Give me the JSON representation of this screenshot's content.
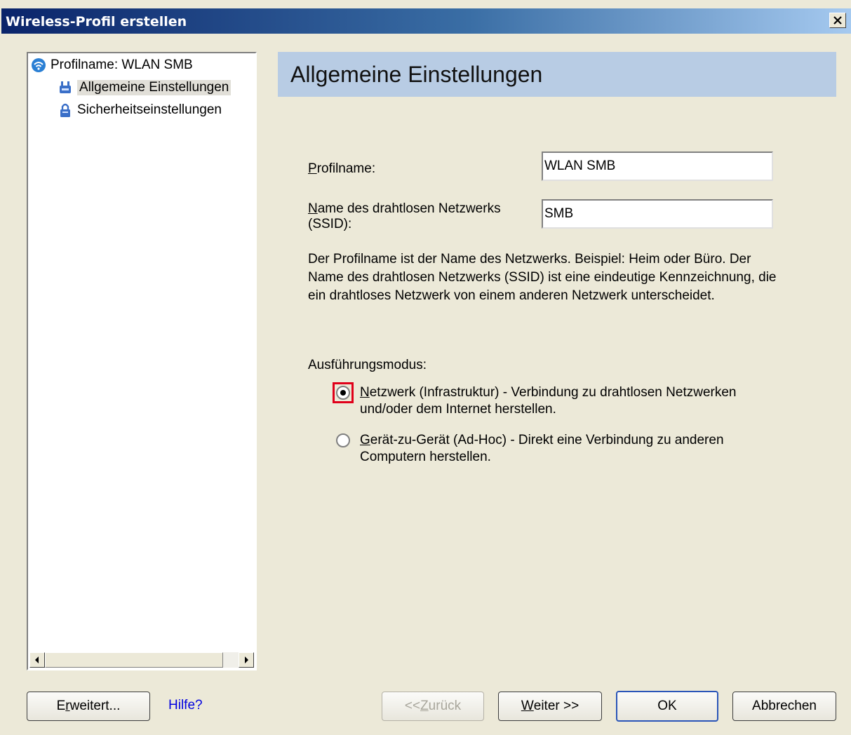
{
  "window": {
    "title": "Wireless-Profil erstellen"
  },
  "tree": {
    "root": "Profilname: WLAN SMB",
    "items": [
      {
        "label": "Allgemeine Einstellungen",
        "icon": "network-adapter-icon",
        "selected": true
      },
      {
        "label": "Sicherheitseinstellungen",
        "icon": "padlock-icon",
        "selected": false
      }
    ]
  },
  "main": {
    "heading": "Allgemeine Einstellungen",
    "profile_label_first": "P",
    "profile_label_rest": "rofilname:",
    "profile_value": "WLAN SMB",
    "ssid_label_first": "N",
    "ssid_label_rest": "ame des drahtlosen Netzwerks",
    "ssid_label_line2": "(SSID):",
    "ssid_value": "SMB",
    "description": "Der Profilname ist der Name des Netzwerks. Beispiel: Heim oder Büro. Der Name des drahtlosen Netzwerks (SSID) ist eine eindeutige Kennzeichnung, die ein drahtloses Netzwerk von einem anderen Netzwerk unterscheidet.",
    "mode_label": "Ausführungsmodus:",
    "mode_options": [
      {
        "key": "N",
        "rest": "etzwerk (Infrastruktur) - Verbindung zu drahtlosen Netzwerken",
        "line2": "und/oder dem Internet herstellen.",
        "selected": true
      },
      {
        "key": "G",
        "rest": "erät-zu-Gerät (Ad-Hoc) - Direkt eine Verbindung zu anderen",
        "line2": "Computern herstellen.",
        "selected": false
      }
    ]
  },
  "buttons": {
    "advanced_pre": "E",
    "advanced_key": "r",
    "advanced_post": "weitert...",
    "help": "Hilfe?",
    "back_pre": "<< ",
    "back_key": "Z",
    "back_post": "urück",
    "next_key": "W",
    "next_post": "eiter >>",
    "ok": "OK",
    "cancel": "Abbrechen"
  },
  "colors": {
    "accent_focus": "#e0001a",
    "banner": "#b8cce4",
    "titlebar": "#0a246a"
  }
}
